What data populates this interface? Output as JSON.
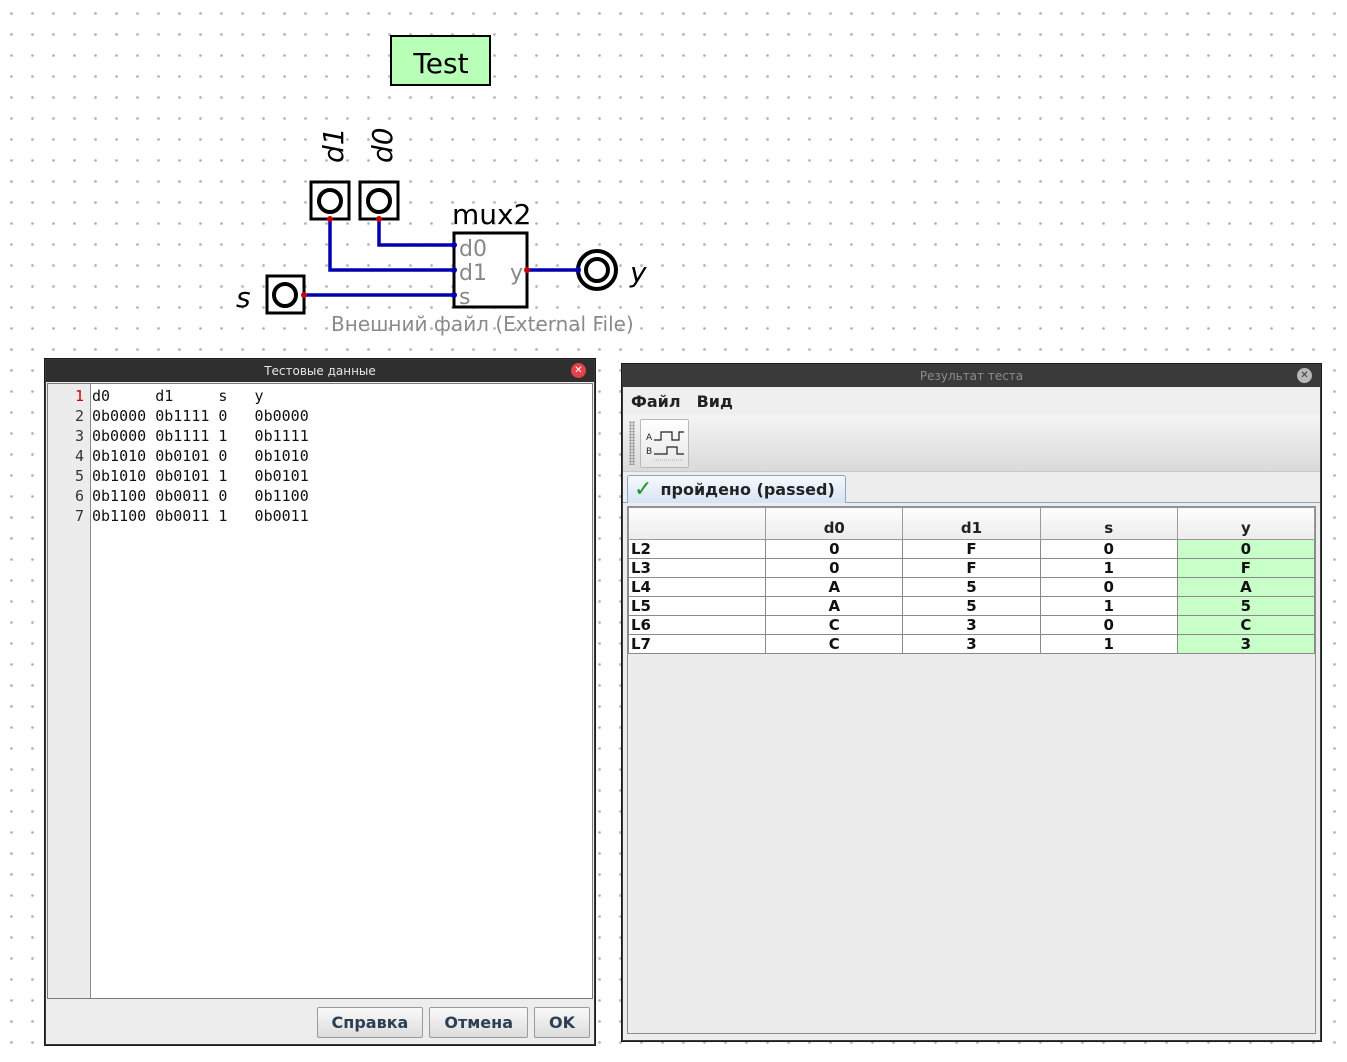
{
  "canvas": {
    "test_label": "Test",
    "inputs": [
      {
        "id": "d1",
        "label": "d1"
      },
      {
        "id": "d0",
        "label": "d0"
      },
      {
        "id": "s",
        "label": "s"
      }
    ],
    "output": {
      "label": "y"
    },
    "mux": {
      "name": "mux2",
      "ports_in": [
        "d0",
        "d1",
        "s"
      ],
      "port_out": "y"
    },
    "external_file_label": "Внешний файл (External File)"
  },
  "testdata_window": {
    "title": "Тестовые данные",
    "line_numbers": [
      "1",
      "2",
      "3",
      "4",
      "5",
      "6",
      "7"
    ],
    "lines": [
      "d0     d1     s   y",
      "0b0000 0b1111 0   0b0000",
      "0b0000 0b1111 1   0b1111",
      "0b1010 0b0101 0   0b1010",
      "0b1010 0b0101 1   0b0101",
      "0b1100 0b0011 0   0b1100",
      "0b1100 0b0011 1   0b0011"
    ],
    "buttons": {
      "help": "Справка",
      "cancel": "Отмена",
      "ok": "OK"
    }
  },
  "result_window": {
    "title": "Результат теста",
    "menu": {
      "file": "Файл",
      "view": "Вид"
    },
    "toolbar_icon": "timing-diagram-icon",
    "tab_label": "пройдено (passed)",
    "columns": [
      "",
      "d0",
      "d1",
      "s",
      "y"
    ],
    "rows": [
      [
        "L2",
        "0",
        "F",
        "0",
        "0"
      ],
      [
        "L3",
        "0",
        "F",
        "1",
        "F"
      ],
      [
        "L4",
        "A",
        "5",
        "0",
        "A"
      ],
      [
        "L5",
        "A",
        "5",
        "1",
        "5"
      ],
      [
        "L6",
        "C",
        "3",
        "0",
        "C"
      ],
      [
        "L7",
        "C",
        "3",
        "1",
        "3"
      ]
    ],
    "pass_color": "#c8ffc8"
  },
  "colors": {
    "wire": "#0000b0",
    "pin": "#cc0000",
    "test_box": "#b8ffb8"
  }
}
